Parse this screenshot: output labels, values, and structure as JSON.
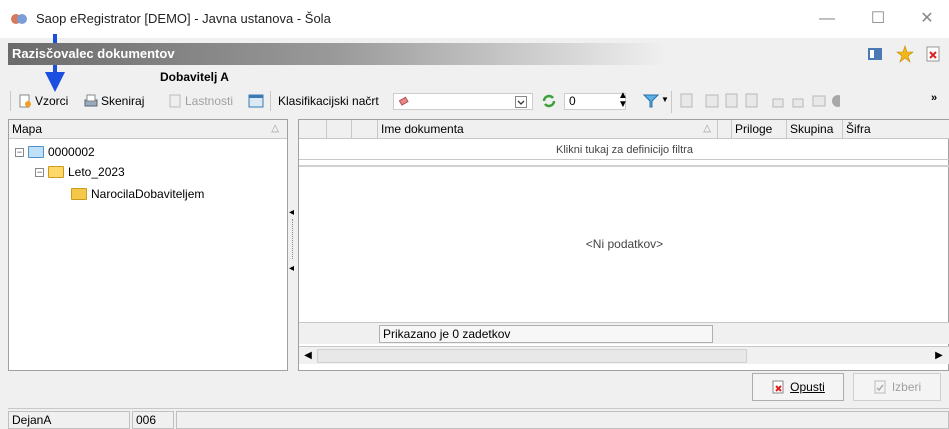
{
  "window": {
    "title": "Saop eRegistrator [DEMO] - Javna ustanova - Šola",
    "minimize": "—",
    "maximize": "☐",
    "close": "✕"
  },
  "header": {
    "title": "Razisčovalec dokumentov"
  },
  "subtitle": "Dobavitelj A",
  "toolbar": {
    "vzorci": "Vzorci",
    "skeniraj": "Skeniraj",
    "lastnosti": "Lastnosti",
    "klasifikacijski": "Klasifikacijski načrt",
    "spin_value": "0",
    "filter_count": "0"
  },
  "tree": {
    "header": "Mapa",
    "nodes": [
      {
        "label": "0000002",
        "level": 0,
        "expander": "⊟"
      },
      {
        "label": "Leto_2023",
        "level": 1,
        "expander": "⊟"
      },
      {
        "label": "NarocilaDobaviteljem",
        "level": 2,
        "expander": ""
      }
    ]
  },
  "grid": {
    "columns": {
      "ime": "Ime dokumenta",
      "priloge": "Priloge",
      "skupina": "Skupina",
      "sifra": "Šifra"
    },
    "filter_hint": "Klikni tukaj za definicijo filtra",
    "empty": "<Ni podatkov>",
    "status": "Prikazano je 0 zadetkov"
  },
  "buttons": {
    "opusti": "Opusti",
    "izberi": "Izberi"
  },
  "statusbar": {
    "user": "DejanA",
    "code": "006"
  },
  "colors": {
    "accent_arrow": "#1a4fe0",
    "folder": "#f6c84a",
    "header_bg": "#6b6b6b"
  }
}
